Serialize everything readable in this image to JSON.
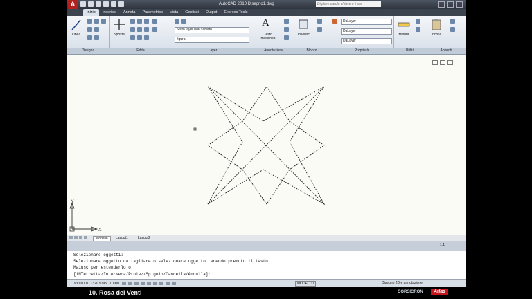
{
  "window": {
    "title": "AutoCAD 2010   Disegno1.dwg",
    "search_placeholder": "Digitare parola chiave o frase"
  },
  "tabs": [
    "Inizio",
    "Inserisci",
    "Annota",
    "Parametrico",
    "Vista",
    "Gestisci",
    "Output",
    "Express Tools"
  ],
  "ribbon": {
    "line_label": "Linea",
    "move_label": "Sposta",
    "layer_state": "Stato layer non salvato",
    "layer_current": "figura",
    "text_label": "Testo multilinea",
    "insert_label": "Inserisci",
    "prop_color": "DaLayer",
    "prop_linetype": "DaLayer",
    "prop_lineweight": "DaLayer",
    "measure_label": "Misura",
    "paste_label": "Incolla",
    "panels": [
      "Disegna",
      "Edita",
      "Layer",
      "Annotazione",
      "Blocco",
      "Proprietà",
      "Utilità",
      "Appunti"
    ]
  },
  "drawing": {
    "axis_y": "Y",
    "axis_x": "X",
    "line_color": "#222222"
  },
  "layout_tabs": [
    "Modello",
    "Layout1",
    "Layout2"
  ],
  "scale": "1:1",
  "command": {
    "lines": [
      "Selezionare oggetti:",
      "Selezionare oggetto da tagliare o selezionare oggetto tenendo premuto il tasto",
      "Maiusc per estenderlo o",
      "[iNTercetta/Interseca/Proiez/Spigolo/Cancella/Annulla]:"
    ]
  },
  "status": {
    "coords": "1930.6001, 1320.9795, 0.0000",
    "model": "MODELLO",
    "workspace": "Disegno 2D e annotazione"
  },
  "footer": {
    "title": "10. Rosa dei Venti",
    "brand1": "CORSICRON",
    "brand2": "Atlas"
  }
}
